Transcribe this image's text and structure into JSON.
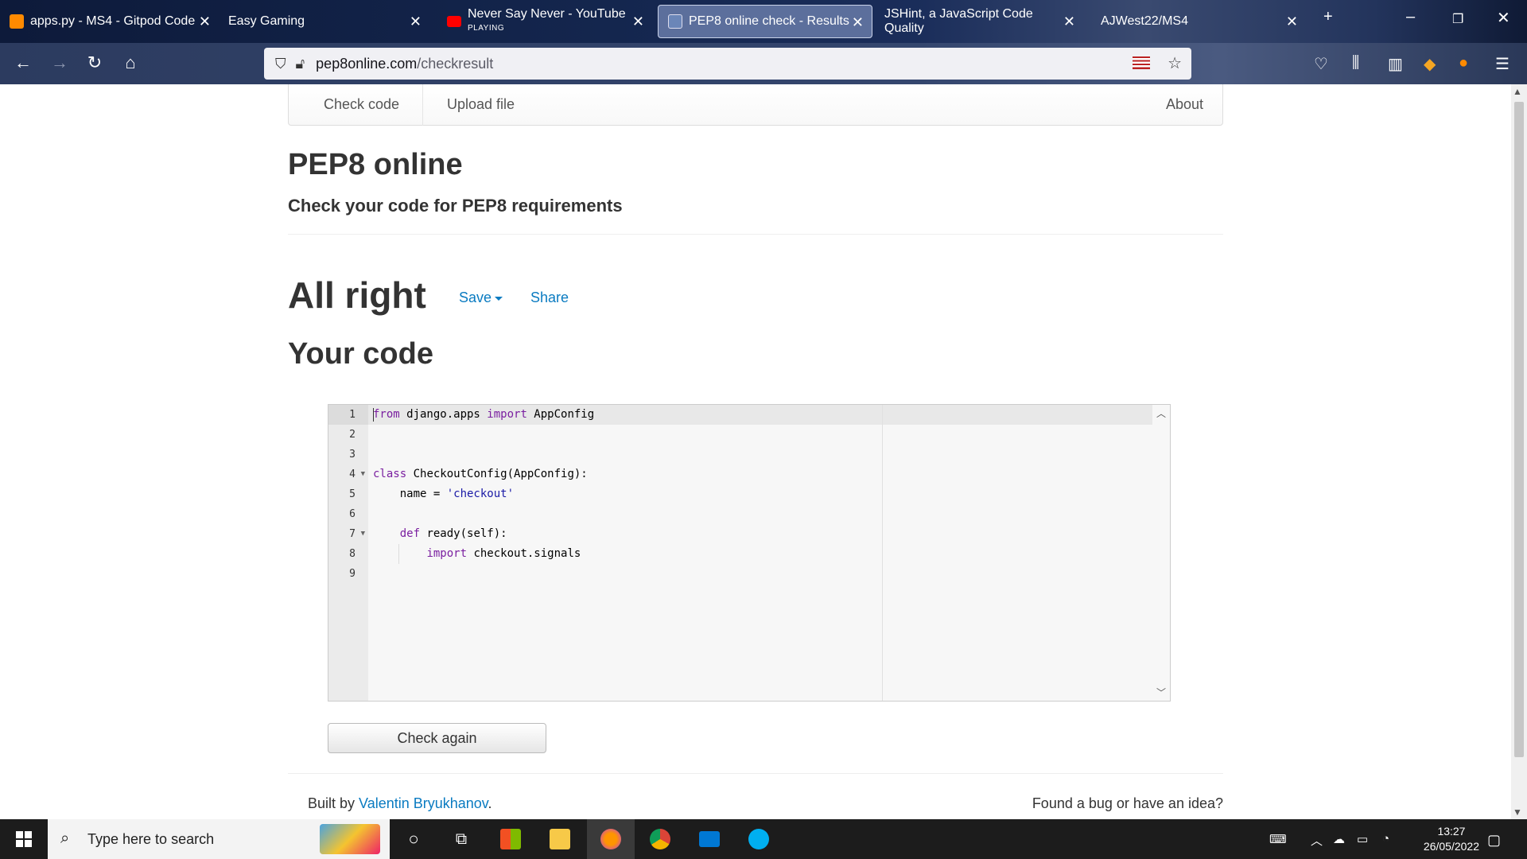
{
  "tabs": [
    {
      "title": "apps.py - MS4 - Gitpod Code"
    },
    {
      "title": "Easy Gaming"
    },
    {
      "title": "Never Say Never - YouTube",
      "sub": "PLAYING"
    },
    {
      "title": "PEP8 online check - Results"
    },
    {
      "title": "JSHint, a JavaScript Code Quality"
    },
    {
      "title": "AJWest22/MS4"
    }
  ],
  "url": {
    "domain": "pep8online.com",
    "path": "/checkresult"
  },
  "topnav": {
    "check_code": "Check code",
    "upload_file": "Upload file",
    "about": "About"
  },
  "header": {
    "title": "PEP8 online",
    "subtitle": "Check your code for PEP8 requirements"
  },
  "result": {
    "status": "All right",
    "save": "Save",
    "share": "Share",
    "your_code": "Your code"
  },
  "editor": {
    "line_numbers": [
      "1",
      "2",
      "3",
      "4",
      "5",
      "6",
      "7",
      "8",
      "9"
    ],
    "lines": [
      {
        "kw1": "from",
        "t1": " django.apps ",
        "kw2": "import",
        "t2": " AppConfig"
      },
      {},
      {},
      {
        "kw1": "class",
        "t1": " CheckoutConfig(AppConfig):"
      },
      {
        "t1": "    name = ",
        "str": "'checkout'"
      },
      {},
      {
        "kw1": "def",
        "t1": " ready(self):",
        "pre": "    "
      },
      {
        "kw1": "import",
        "t1": " checkout.signals",
        "pre": "        "
      },
      {}
    ]
  },
  "buttons": {
    "check_again": "Check again"
  },
  "footer": {
    "built_by": "Built by ",
    "author": "Valentin Bryukhanov",
    "period": ".",
    "bug": "Found a bug or have an idea?"
  },
  "taskbar": {
    "search_placeholder": "Type here to search",
    "time": "13:27",
    "date": "26/05/2022"
  }
}
